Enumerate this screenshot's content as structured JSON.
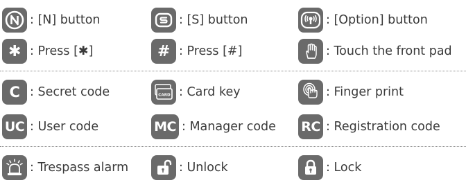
{
  "legend": {
    "rows": [
      [
        {
          "icon": "n-circle-button-icon",
          "label": ": [N] button"
        },
        {
          "icon": "s-button-icon",
          "label": ": [S] button"
        },
        {
          "icon": "option-button-icon",
          "label": ": [Option] button"
        }
      ],
      [
        {
          "icon": "asterisk-key-icon",
          "glyph": "✱",
          "label": ": Press [✱]"
        },
        {
          "icon": "hash-key-icon",
          "glyph": "#",
          "label": ": Press [#]"
        },
        {
          "icon": "touch-hand-icon",
          "label": ": Touch the front pad"
        }
      ],
      [
        {
          "icon": "secret-code-icon",
          "glyph": "C",
          "label": ": Secret code"
        },
        {
          "icon": "card-key-icon",
          "card_text": "CARD",
          "label": ": Card key"
        },
        {
          "icon": "fingerprint-icon",
          "label": ": Finger print"
        }
      ],
      [
        {
          "icon": "user-code-icon",
          "glyph": "UC",
          "label": ": User code"
        },
        {
          "icon": "manager-code-icon",
          "glyph": "MC",
          "label": ": Manager code"
        },
        {
          "icon": "registration-code-icon",
          "glyph": "RC",
          "label": ": Registration code"
        }
      ],
      [
        {
          "icon": "alarm-siren-icon",
          "label": ": Trespass alarm"
        },
        {
          "icon": "unlock-icon",
          "label": ": Unlock"
        },
        {
          "icon": "lock-icon",
          "label": ": Lock"
        }
      ]
    ]
  },
  "colors": {
    "icon_bg": "#6a6a6a",
    "icon_fg": "#ffffff",
    "text": "#3a3a3a",
    "separator": "#8a8a8a"
  }
}
